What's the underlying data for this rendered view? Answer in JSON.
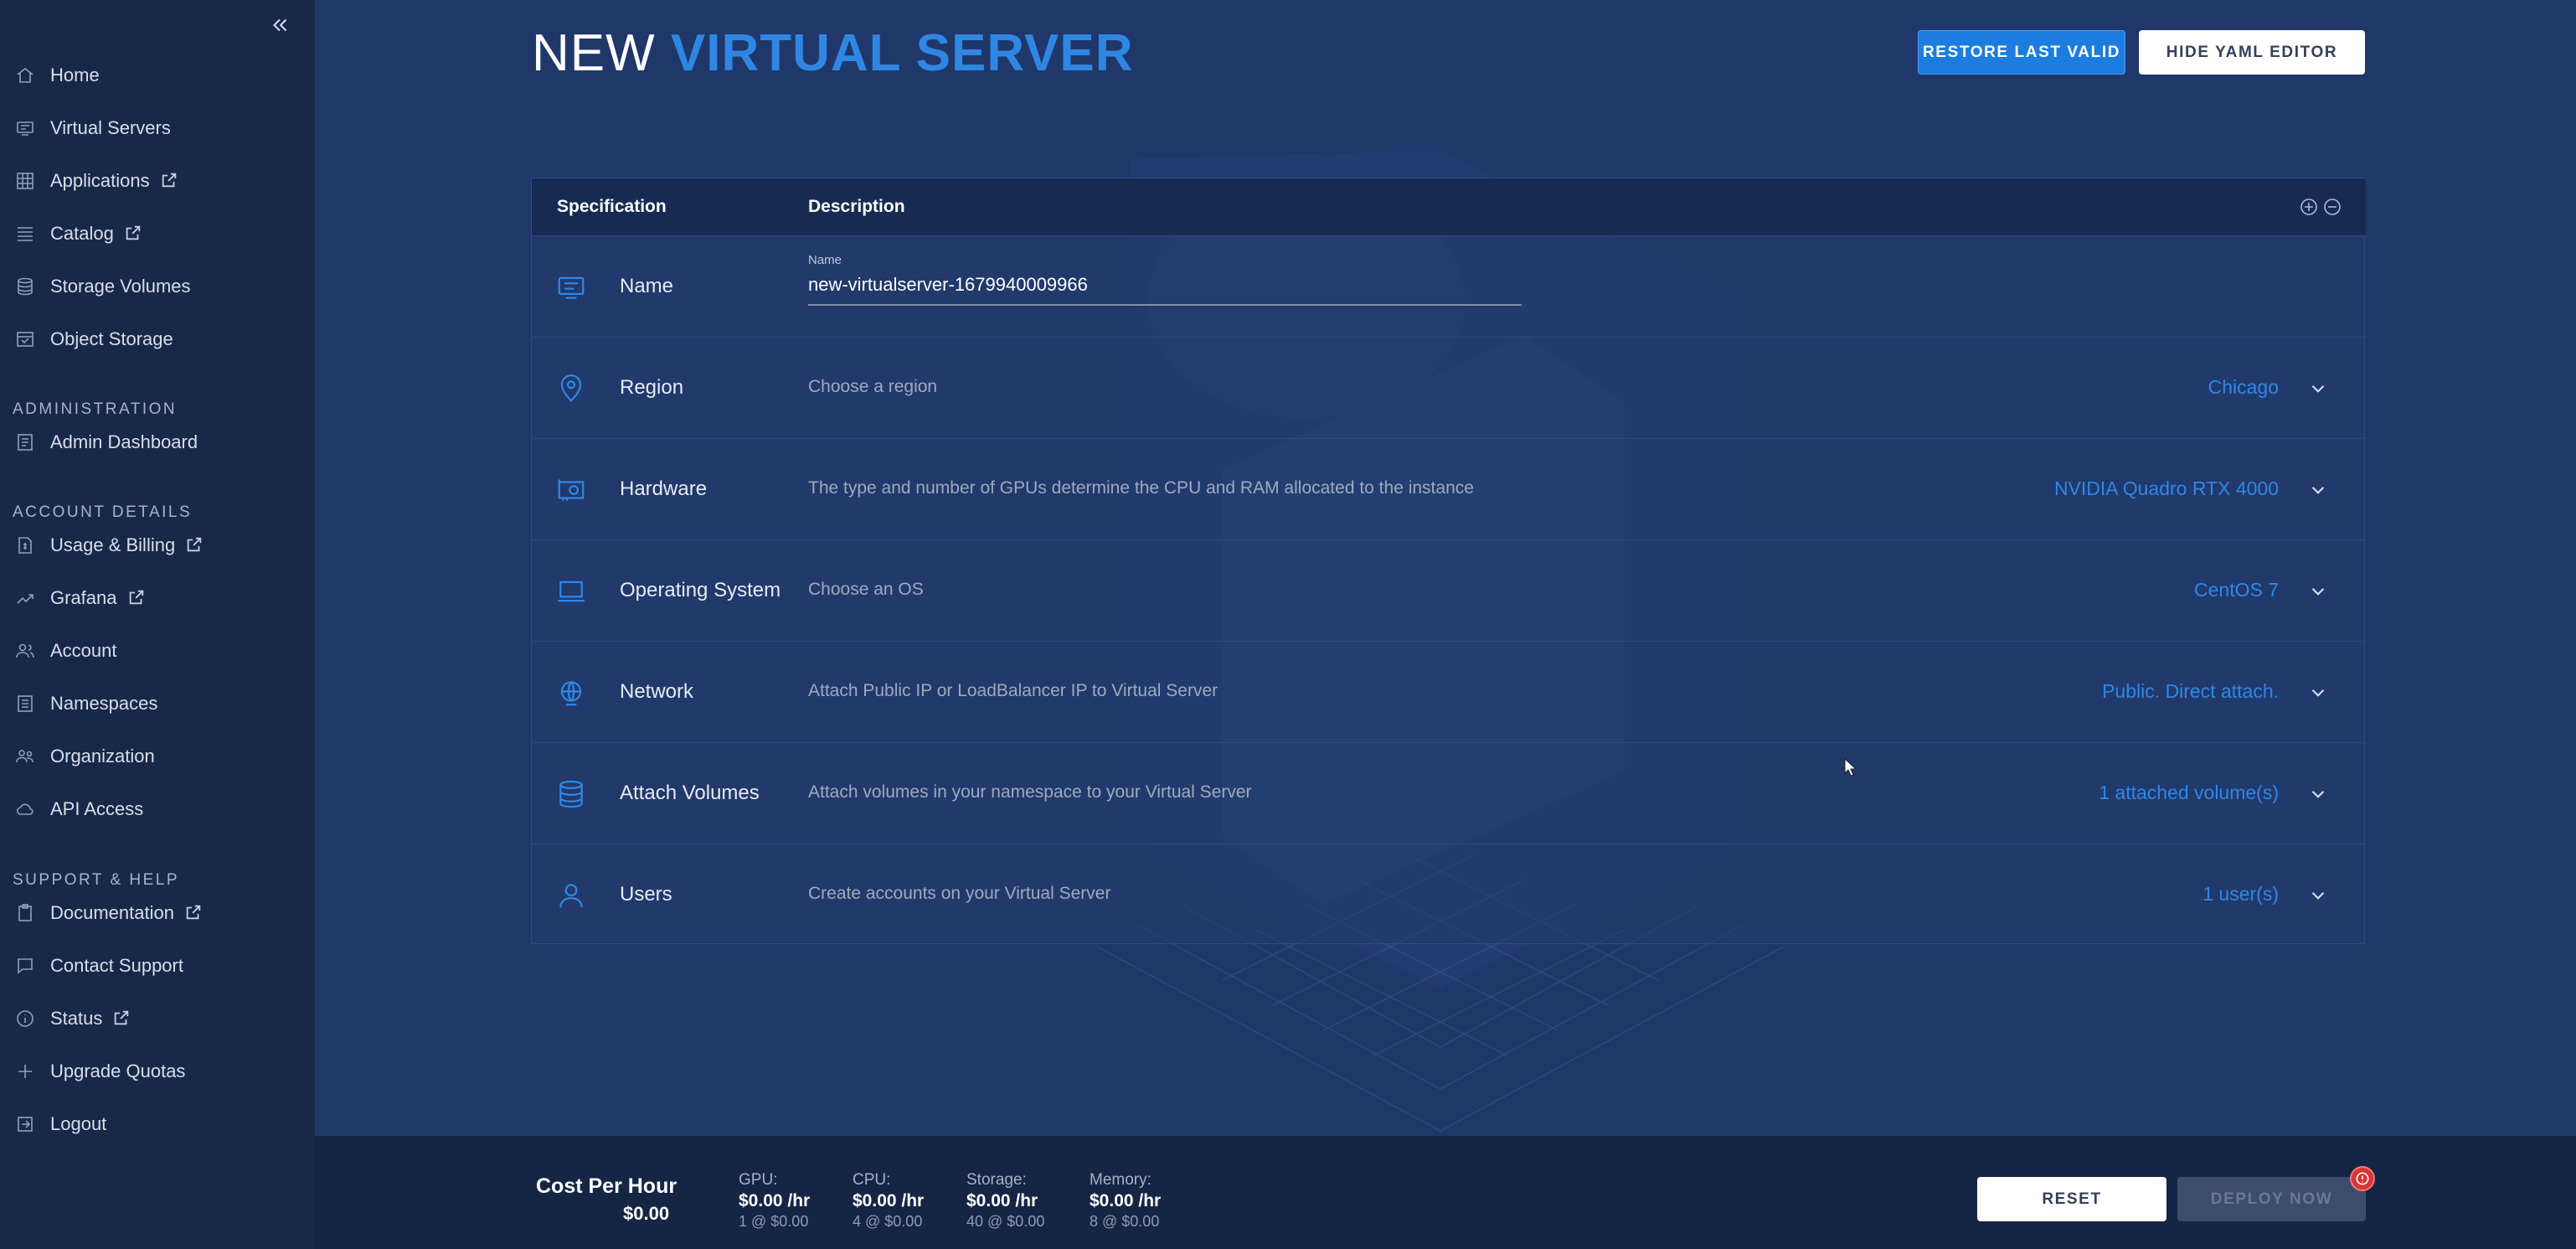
{
  "sidebar": {
    "items": [
      {
        "label": "Home",
        "icon": "home-icon"
      },
      {
        "label": "Virtual Servers",
        "icon": "server-icon"
      },
      {
        "label": "Applications",
        "icon": "grid-icon",
        "external": true
      },
      {
        "label": "Catalog",
        "icon": "list-icon",
        "external": true
      },
      {
        "label": "Storage Volumes",
        "icon": "database-icon"
      },
      {
        "label": "Object Storage",
        "icon": "bucket-icon"
      }
    ],
    "admin_heading": "ADMINISTRATION",
    "admin_items": [
      {
        "label": "Admin Dashboard",
        "icon": "dashboard-icon"
      }
    ],
    "account_heading": "ACCOUNT DETAILS",
    "account_items": [
      {
        "label": "Usage & Billing",
        "icon": "invoice-icon",
        "external": true
      },
      {
        "label": "Grafana",
        "icon": "trend-icon",
        "external": true
      },
      {
        "label": "Account",
        "icon": "user-group-icon"
      },
      {
        "label": "Namespaces",
        "icon": "namespace-icon"
      },
      {
        "label": "Organization",
        "icon": "organization-icon"
      },
      {
        "label": "API Access",
        "icon": "cloud-icon"
      }
    ],
    "support_heading": "SUPPORT & HELP",
    "support_items": [
      {
        "label": "Documentation",
        "icon": "clipboard-icon",
        "external": true
      },
      {
        "label": "Contact Support",
        "icon": "chat-icon"
      },
      {
        "label": "Status",
        "icon": "info-icon",
        "external": true
      },
      {
        "label": "Upgrade Quotas",
        "icon": "plus-icon"
      },
      {
        "label": "Logout",
        "icon": "logout-icon"
      }
    ]
  },
  "header": {
    "title_plain": "NEW",
    "title_accent": "VIRTUAL SERVER",
    "restore_label": "RESTORE LAST VALID",
    "hide_yaml_label": "HIDE YAML EDITOR"
  },
  "panel": {
    "col_spec": "Specification",
    "col_desc": "Description",
    "name_row": {
      "title": "Name",
      "field_label": "Name",
      "field_value": "new-virtualserver-1679940009966"
    },
    "rows": [
      {
        "title": "Region",
        "description": "Choose a region",
        "value": "Chicago",
        "icon": "location-pin-icon"
      },
      {
        "title": "Hardware",
        "description": "The type and number of GPUs determine the CPU and RAM allocated to the instance",
        "value": "NVIDIA Quadro RTX 4000",
        "icon": "gpu-card-icon"
      },
      {
        "title": "Operating System",
        "description": "Choose an OS",
        "value": "CentOS 7",
        "icon": "laptop-icon"
      },
      {
        "title": "Network",
        "description": "Attach Public IP or LoadBalancer IP to Virtual Server",
        "value": "Public. Direct attach.",
        "icon": "globe-icon"
      },
      {
        "title": "Attach Volumes",
        "description": "Attach volumes in your namespace to your Virtual Server",
        "value": "1 attached volume(s)",
        "icon": "database-icon"
      },
      {
        "title": "Users",
        "description": "Create accounts on your Virtual Server",
        "value": "1 user(s)",
        "icon": "user-icon"
      }
    ]
  },
  "footer": {
    "cost_title": "Cost Per Hour",
    "cost_total": "$0.00",
    "gpu": {
      "label": "GPU:",
      "rate": "$0.00 /hr",
      "sub": "1 @ $0.00"
    },
    "cpu": {
      "label": "CPU:",
      "rate": "$0.00 /hr",
      "sub": "4 @ $0.00"
    },
    "storage": {
      "label": "Storage:",
      "rate": "$0.00 /hr",
      "sub": "40 @ $0.00"
    },
    "memory": {
      "label": "Memory:",
      "rate": "$0.00 /hr",
      "sub": "8 @ $0.00"
    },
    "reset_label": "RESET",
    "deploy_label": "DEPLOY NOW"
  },
  "colors": {
    "accent": "#2f87e3",
    "background": "#20376a",
    "sidebar": "#172849",
    "alert": "#d93535"
  }
}
